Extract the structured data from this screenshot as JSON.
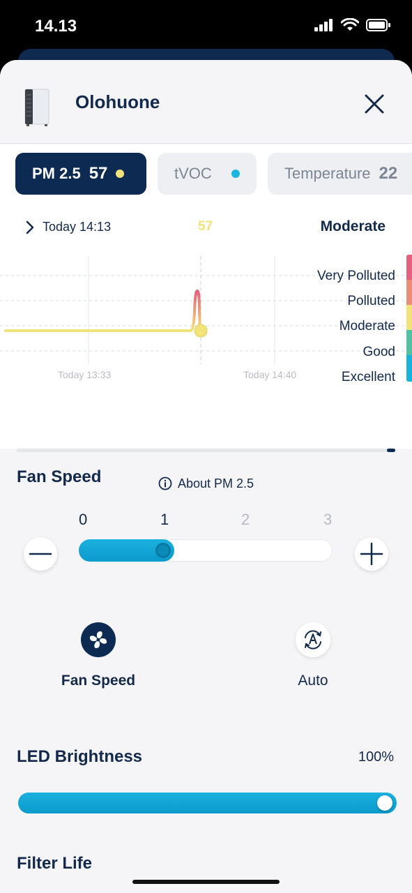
{
  "status_bar": {
    "time": "14.13"
  },
  "header": {
    "device_name": "Olohuone"
  },
  "tabs": [
    {
      "label": "PM 2.5",
      "value": "57",
      "dot_color": "#f2e27a"
    },
    {
      "label": "tVOC",
      "value": "",
      "dot_color": "#1ab5e0"
    },
    {
      "label": "Temperature",
      "value": "22"
    }
  ],
  "chart_info": {
    "time": "Today 14:13",
    "current_value": "57",
    "current_level": "Moderate"
  },
  "chart_data": {
    "type": "line",
    "series": [
      {
        "x": [
          "13:33",
          "13:55",
          "14:11",
          "14:12",
          "14:13"
        ],
        "y": [
          30,
          30,
          30,
          57,
          35
        ]
      }
    ],
    "x_tick_labels": [
      "Today 13:33",
      "Today 14:40"
    ],
    "levels": [
      {
        "label": "Very Polluted",
        "color": "#e4607c"
      },
      {
        "label": "Polluted",
        "color": "#eb8e78"
      },
      {
        "label": "Moderate",
        "color": "#f2e27a"
      },
      {
        "label": "Good",
        "color": "#4fc3a1"
      },
      {
        "label": "Excellent",
        "color": "#15b4dc"
      }
    ],
    "current_level": "Moderate"
  },
  "about_link": "About PM 2.5",
  "fan_speed": {
    "title": "Fan Speed",
    "levels": [
      "0",
      "1",
      "2",
      "3"
    ],
    "current": 1,
    "max": 3
  },
  "modes": [
    {
      "label": "Fan Speed",
      "icon": "fan-icon",
      "selected": true
    },
    {
      "label": "Auto",
      "icon": "auto-mode-icon",
      "selected": false
    }
  ],
  "led": {
    "title": "LED Brightness",
    "value_text": "100%",
    "value": 1.0
  },
  "filter": {
    "title": "Filter Life"
  },
  "colors": {
    "navy": "#13294b",
    "accent": "#1ab0de",
    "moderate": "#f2e27a"
  }
}
